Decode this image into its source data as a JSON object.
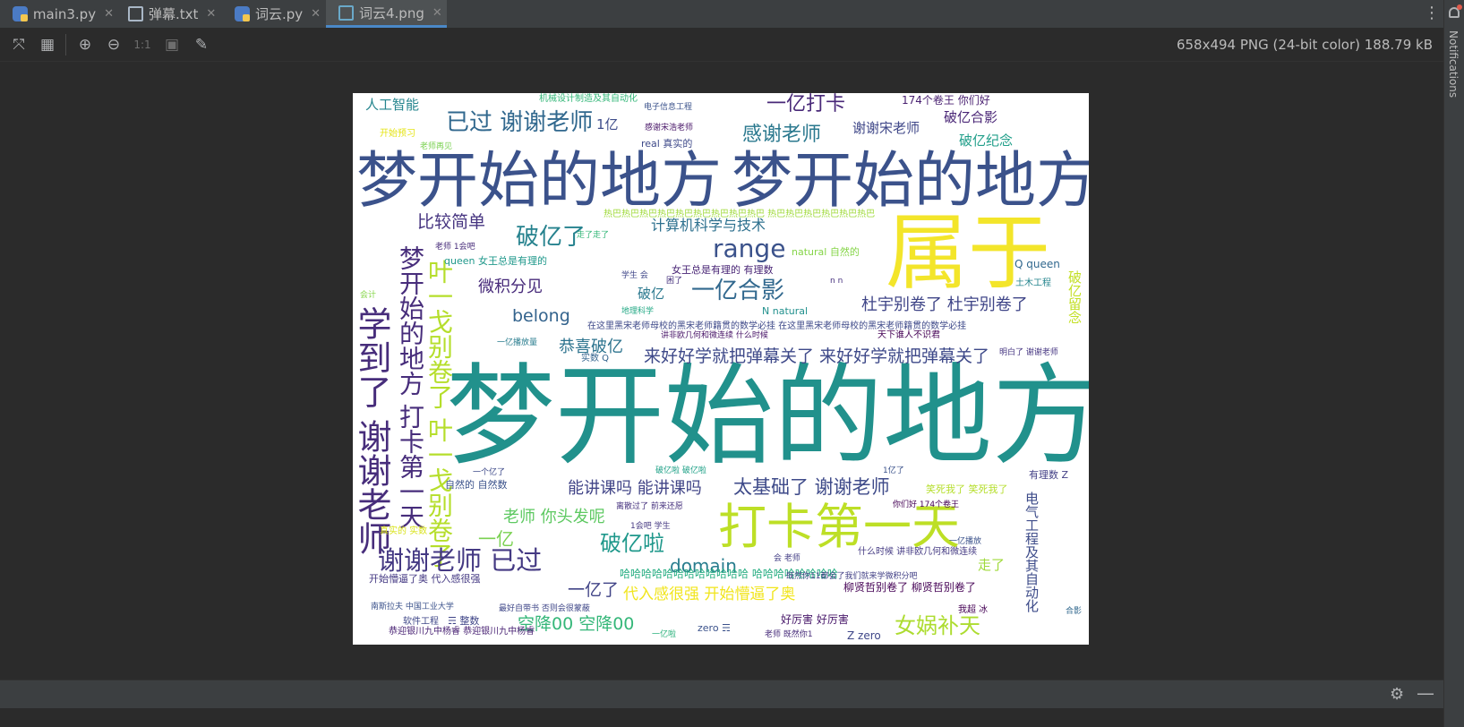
{
  "tabs": [
    {
      "label": "main3.py",
      "icon": "python-file-icon"
    },
    {
      "label": "弹幕.txt",
      "icon": "text-file-icon"
    },
    {
      "label": "词云.py",
      "icon": "python-file-icon"
    },
    {
      "label": "词云4.png",
      "icon": "image-file-icon",
      "active": true
    }
  ],
  "tab_close_glyph": "✕",
  "toolbar": {
    "actual_size_label": "1:1",
    "image_info": "658x494 PNG (24-bit color) 188.79 kB"
  },
  "right_panel": {
    "notifications_label": "Notifications"
  },
  "wordcloud": {
    "words": [
      {
        "text": "梦开始的地方",
        "color": "#21918c"
      },
      {
        "text": "梦开始的地方",
        "color": "#3b528b"
      },
      {
        "text": "梦开始的地方",
        "color": "#3b528b"
      },
      {
        "text": "属于",
        "color": "#f3e52a"
      },
      {
        "text": "打卡第一天",
        "color": "#bddf26"
      },
      {
        "text": "学到了 谢谢老师",
        "color": "#472d7b"
      },
      {
        "text": "梦开始的地方 打卡第一天",
        "color": "#472d7b"
      },
      {
        "text": "叶一戈别卷了 叶一戈别卷了",
        "color": "#b5de2b"
      },
      {
        "text": "谢谢老师 已过",
        "color": "#443983"
      },
      {
        "text": "已过 谢谢老师",
        "color": "#31688e"
      },
      {
        "text": "破亿了",
        "color": "#26828e"
      },
      {
        "text": "range",
        "color": "#3b528b"
      },
      {
        "text": "一亿合影",
        "color": "#31688e"
      },
      {
        "text": "感谢老师",
        "color": "#2a788e"
      },
      {
        "text": "一亿打卡",
        "color": "#482878"
      },
      {
        "text": "破亿啦",
        "color": "#1f988b"
      },
      {
        "text": "女娲补天",
        "color": "#addc30"
      },
      {
        "text": "太基础了 谢谢老师",
        "color": "#3e4a89"
      },
      {
        "text": "来好好学就把弹幕关了 来好好学就把弹幕关了",
        "color": "#3e4989"
      },
      {
        "text": "杜宇别卷了 杜宇别卷了",
        "color": "#404688"
      },
      {
        "text": "能讲课吗 能讲课吗",
        "color": "#414487"
      },
      {
        "text": "恭喜破亿",
        "color": "#2c738e"
      },
      {
        "text": "微积分见",
        "color": "#472a7a"
      },
      {
        "text": "比较简单",
        "color": "#463480"
      },
      {
        "text": "计算机科学与技术",
        "color": "#2d708e"
      },
      {
        "text": "domain",
        "color": "#287d8e"
      },
      {
        "text": "belong",
        "color": "#33638d"
      },
      {
        "text": "老师 你头发呢",
        "color": "#5ec962"
      },
      {
        "text": "空降00 空降00",
        "color": "#35b779"
      },
      {
        "text": "代入感很强 开始懵逼了奥",
        "color": "#f1e51d"
      },
      {
        "text": "一亿了",
        "color": "#414487"
      },
      {
        "text": "一亿",
        "color": "#7ad151"
      },
      {
        "text": "破亿合影",
        "color": "#482475"
      },
      {
        "text": "破亿纪念",
        "color": "#1f9e89"
      },
      {
        "text": "谢谢宋老师",
        "color": "#3f4788"
      },
      {
        "text": "人工智能",
        "color": "#25858e"
      },
      {
        "text": "1亿",
        "color": "#3e4c8a"
      },
      {
        "text": "174个卷王 你们好",
        "color": "#481f70"
      },
      {
        "text": "电气工程及其自动化",
        "color": "#3e4c8a"
      },
      {
        "text": "破亿留念",
        "color": "#c2df23"
      },
      {
        "text": "走了",
        "color": "#9fda3a"
      },
      {
        "text": "好厉害 好厉害",
        "color": "#48186a"
      },
      {
        "text": "柳贤哲别卷了 柳贤哲别卷了",
        "color": "#440154"
      },
      {
        "text": "Z zero",
        "color": "#3f4788"
      },
      {
        "text": "有理数 Z",
        "color": "#423f85"
      },
      {
        "text": "笑死我了 笑死我了",
        "color": "#b5de2b"
      },
      {
        "text": "哈哈哈哈哈哈哈哈哈哈哈哈 哈哈哈哈哈哈哈哈",
        "color": "#26ad81"
      },
      {
        "text": "热巴热巴热巴热巴热巴热巴热巴热巴热巴 热巴热巴热巴热巴热巴热巴",
        "color": "#9fda3a"
      },
      {
        "text": "在这里黑宋老师母校的黑宋老师籍贯的数学必挂 在这里黑宋老师母校的黑宋老师籍贯的数学必挂",
        "color": "#3e4989"
      },
      {
        "text": "女王总是有理的 有理数",
        "color": "#482475"
      },
      {
        "text": "queen 女王总是有理的",
        "color": "#1f988b"
      },
      {
        "text": "natural 自然的",
        "color": "#86d549"
      },
      {
        "text": "Q queen",
        "color": "#31688e"
      },
      {
        "text": "自然的 自然数",
        "color": "#3b528b"
      },
      {
        "text": "real 真实的",
        "color": "#3e4989"
      },
      {
        "text": "开始懵逼了奥 代入感很强",
        "color": "#443983"
      },
      {
        "text": "恭迎银川九中杨睿 恭迎银川九中杨睿",
        "color": "#482173"
      },
      {
        "text": "N natural",
        "color": "#21908d"
      },
      {
        "text": "土木工程",
        "color": "#25858e"
      },
      {
        "text": "机械设计制造及其自动化",
        "color": "#35b779"
      },
      {
        "text": "天下谁人不识君",
        "color": "#440154"
      },
      {
        "text": "明白了 谢谢老师",
        "color": "#453581"
      },
      {
        "text": "真实的 实数",
        "color": "#d8e219"
      },
      {
        "text": "软件工程",
        "color": "#3f4788"
      },
      {
        "text": "开始预习",
        "color": "#e5e419"
      },
      {
        "text": "学生 会",
        "color": "#3f4788"
      },
      {
        "text": "老师 1会吧",
        "color": "#472c7a"
      },
      {
        "text": "破亿",
        "color": "#2a788e"
      },
      {
        "text": "实数 Q",
        "color": "#33638d"
      },
      {
        "text": "一亿播放量",
        "color": "#287c8e"
      },
      {
        "text": "讲非欧几何和微连续 什么时候",
        "color": "#481467"
      },
      {
        "text": "什么时候 讲非欧几何和微连续",
        "color": "#443a83"
      },
      {
        "text": "感谢宋浩老师",
        "color": "#481668"
      },
      {
        "text": "电子信息工程",
        "color": "#3b528b"
      },
      {
        "text": "会计",
        "color": "#86d549"
      },
      {
        "text": "我超 冰",
        "color": "#440154"
      },
      {
        "text": "合影",
        "color": "#31688e"
      },
      {
        "text": "zero ☴",
        "color": "#3b528b"
      },
      {
        "text": "☴ 整数",
        "color": "#404688"
      },
      {
        "text": "你们好 174个卷王",
        "color": "#440154"
      },
      {
        "text": "一亿播放",
        "color": "#3b528b"
      },
      {
        "text": "老师 既然你1",
        "color": "#472c7a"
      },
      {
        "text": "一亿啦",
        "color": "#2db27d"
      },
      {
        "text": "1会吧 学生",
        "color": "#453882"
      },
      {
        "text": "破亿啦 破亿啦",
        "color": "#1fa187"
      },
      {
        "text": "1亿了",
        "color": "#3b528b"
      },
      {
        "text": "一个亿了",
        "color": "#3e4a89"
      },
      {
        "text": "会 老师",
        "color": "#433e85"
      },
      {
        "text": "困了",
        "color": "#46327e"
      },
      {
        "text": "n n",
        "color": "#46307e"
      },
      {
        "text": "老师再见",
        "color": "#7ad151"
      },
      {
        "text": "最好自带书 否则会很蒙蔽",
        "color": "#3f4788"
      },
      {
        "text": "既然你11都会了我们就来学微积分吧",
        "color": "#424086"
      },
      {
        "text": "南斯拉夫 中国工业大学",
        "color": "#3b528b"
      },
      {
        "text": "离散过了 前来还愿",
        "color": "#46327e"
      },
      {
        "text": "走了走了",
        "color": "#35b779"
      },
      {
        "text": "地理科学",
        "color": "#22a884"
      }
    ]
  }
}
